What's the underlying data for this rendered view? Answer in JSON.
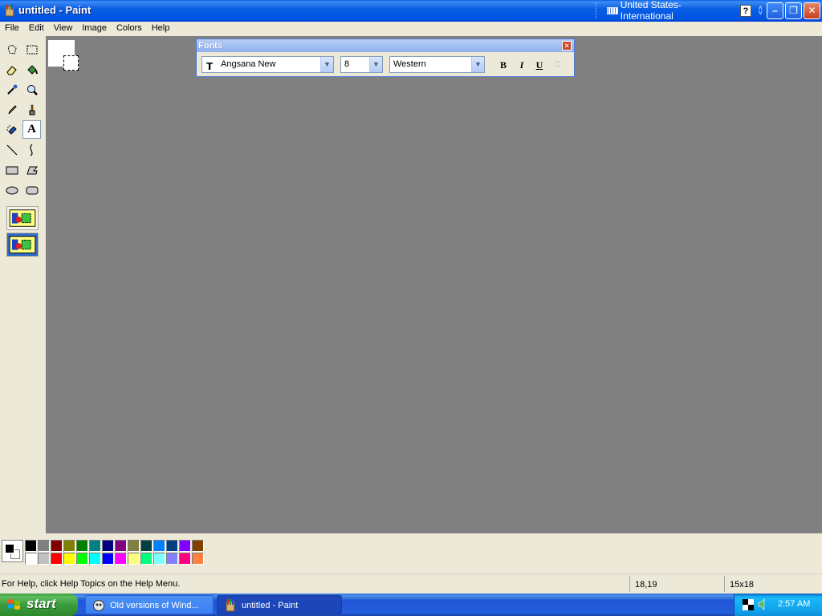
{
  "window": {
    "title": "untitled - Paint",
    "language": "United States-International",
    "help_glyph": "?"
  },
  "menu": [
    "File",
    "Edit",
    "View",
    "Image",
    "Colors",
    "Help"
  ],
  "fonts_toolbar": {
    "title": "Fonts",
    "font_name": "Angsana New",
    "font_size": "8",
    "script": "Western",
    "bold_label": "B",
    "italic_label": "I",
    "underline_label": "U"
  },
  "tools": [
    {
      "name": "free-form-select",
      "icon": "free-form-select-icon"
    },
    {
      "name": "rectangle-select",
      "icon": "rectangle-select-icon"
    },
    {
      "name": "eraser",
      "icon": "eraser-icon"
    },
    {
      "name": "fill-with-color",
      "icon": "paint-bucket-icon"
    },
    {
      "name": "pick-color",
      "icon": "eyedropper-icon"
    },
    {
      "name": "magnifier",
      "icon": "magnifier-icon"
    },
    {
      "name": "pencil",
      "icon": "pencil-icon"
    },
    {
      "name": "brush",
      "icon": "brush-icon"
    },
    {
      "name": "airbrush",
      "icon": "airbrush-icon"
    },
    {
      "name": "text",
      "icon": "text-icon",
      "label": "A",
      "active": true
    },
    {
      "name": "line",
      "icon": "line-icon"
    },
    {
      "name": "curve",
      "icon": "curve-icon"
    },
    {
      "name": "rectangle",
      "icon": "rectangle-icon"
    },
    {
      "name": "polygon",
      "icon": "polygon-icon"
    },
    {
      "name": "ellipse",
      "icon": "ellipse-icon"
    },
    {
      "name": "rounded-rectangle",
      "icon": "rounded-rectangle-icon"
    }
  ],
  "palette": {
    "foreground": "#000000",
    "background": "#ffffff",
    "row1": [
      "#000000",
      "#808080",
      "#800000",
      "#808000",
      "#008000",
      "#008080",
      "#000080",
      "#800080",
      "#808040",
      "#004040",
      "#0080ff",
      "#004080",
      "#8000ff",
      "#804000"
    ],
    "row2": [
      "#ffffff",
      "#c0c0c0",
      "#ff0000",
      "#ffff00",
      "#00ff00",
      "#00ffff",
      "#0000ff",
      "#ff00ff",
      "#ffff80",
      "#00ff80",
      "#80ffff",
      "#8080ff",
      "#ff0080",
      "#ff8040"
    ]
  },
  "status": {
    "help": "For Help, click Help Topics on the Help Menu.",
    "position": "18,19",
    "size": "15x18"
  },
  "taskbar": {
    "start": "start",
    "tasks": [
      "Old versions of Wind...",
      "untitled - Paint"
    ],
    "clock": "2:57 AM"
  }
}
